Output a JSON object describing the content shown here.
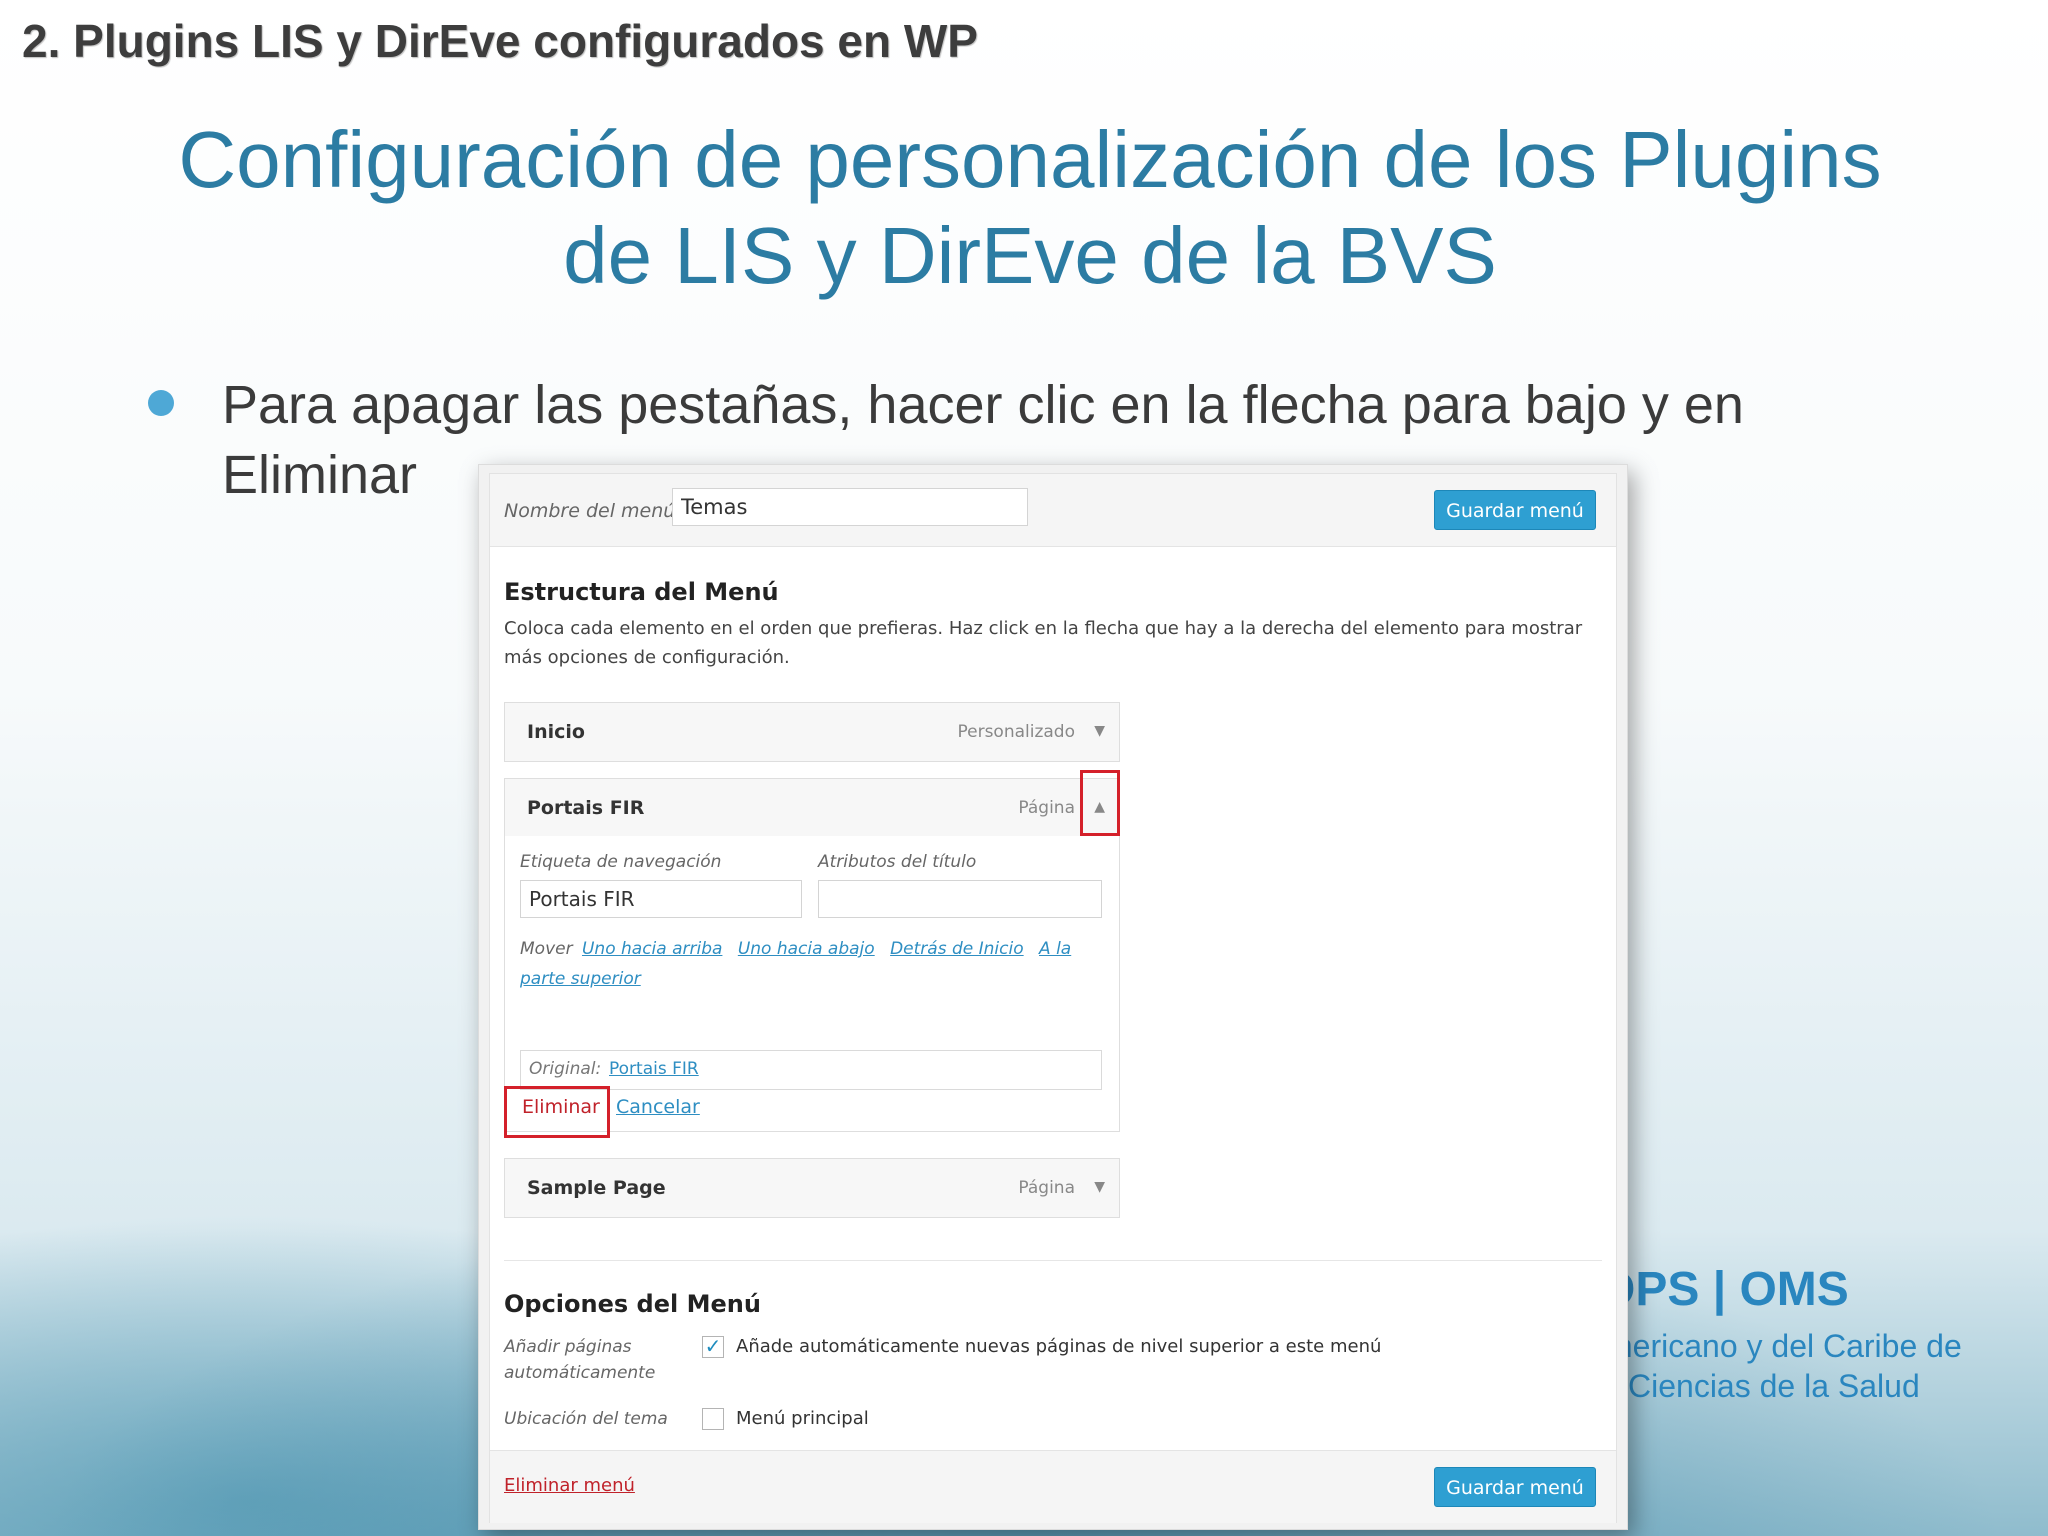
{
  "slide": {
    "header": "2. Plugins LIS y DirEve configurados en WP",
    "title_line1": "Configuración de personalización de los Plugins",
    "title_line2": "de LIS y DirEve de la BVS",
    "bullet_line1": "Para apagar las pestañas, hacer clic en la flecha para bajo y en",
    "bullet_line2": "Eliminar",
    "logo": {
      "brand": "OPS | OMS",
      "sub1": "mericano y del Caribe de",
      "sub2": "Ciencias de la Salud",
      "color": "#2a86bf"
    }
  },
  "wp": {
    "menu_name_label": "Nombre del menú",
    "menu_name_value": "Temas",
    "save_label": "Guardar menú",
    "structure_title": "Estructura del Menú",
    "structure_desc": "Coloca cada elemento en el orden que prefieras. Haz click en la flecha que hay a la derecha del elemento para mostrar más opciones de configuración.",
    "items": [
      {
        "name": "Inicio",
        "type": "Personalizado"
      },
      {
        "name": "Portais FIR",
        "type": "Página"
      },
      {
        "name": "Sample Page",
        "type": "Página"
      }
    ],
    "expanded": {
      "nav_label_label": "Etiqueta de navegación",
      "nav_label_value": "Portais FIR",
      "title_attr_label": "Atributos del título",
      "title_attr_value": "",
      "move_label": "Mover",
      "move_links": [
        "Uno hacia arriba",
        "Uno hacia abajo",
        "Detrás de Inicio",
        "A la parte superior"
      ],
      "original_label": "Original:",
      "original_link": "Portais FIR",
      "remove_label": "Eliminar",
      "cancel_label": "Cancelar"
    },
    "options_title": "Opciones del Menú",
    "auto_add_label_1": "Añadir páginas",
    "auto_add_label_2": "automáticamente",
    "auto_add_text": "Añade automáticamente nuevas páginas de nivel superior a este menú",
    "auto_add_checked": true,
    "location_label": "Ubicación del tema",
    "location_text": "Menú principal",
    "location_checked": false,
    "delete_menu_label": "Eliminar menú",
    "colors": {
      "primary": "#2e9fd2",
      "highlight": "#d4202a",
      "link": "#2e8ec2"
    }
  }
}
